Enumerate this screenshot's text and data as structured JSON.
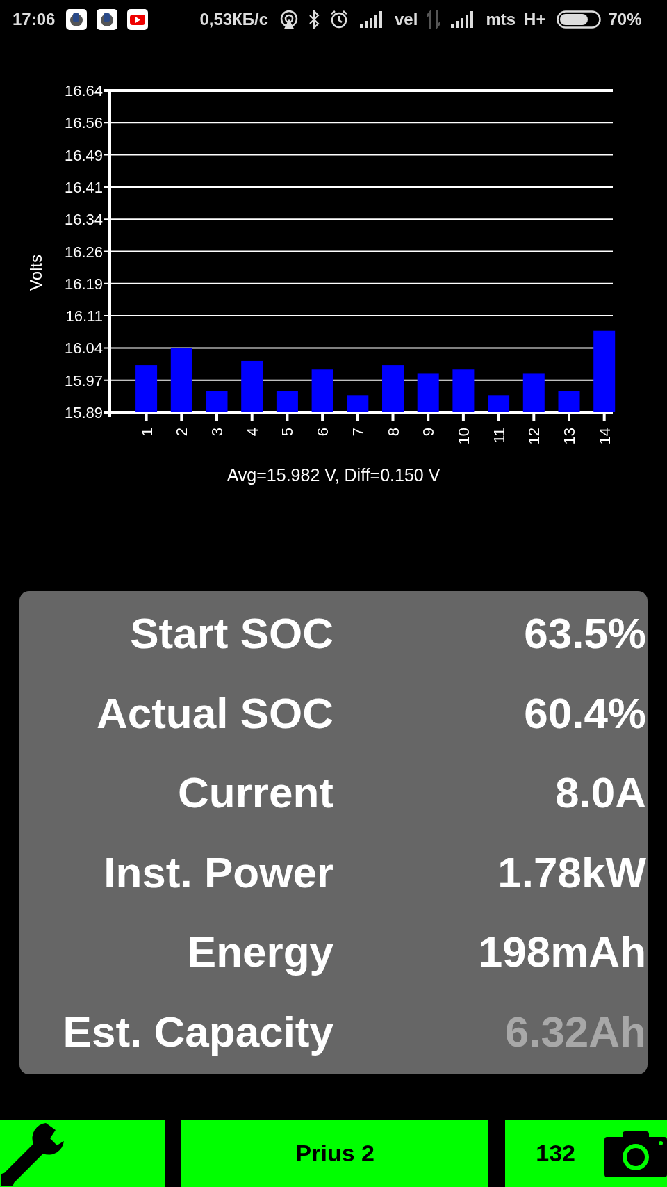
{
  "status_bar": {
    "time": "17:06",
    "speed": "0,53КБ/с",
    "carrier_1": "vel",
    "carrier_2": "mts",
    "network_type": "H+",
    "battery": "70%"
  },
  "chart": {
    "chart_data": {
      "type": "bar",
      "ylabel": "Volts",
      "categories": [
        "1",
        "2",
        "3",
        "4",
        "5",
        "6",
        "7",
        "8",
        "9",
        "10",
        "11",
        "12",
        "13",
        "14"
      ],
      "grid": true,
      "series": [
        {
          "color": "#0000ff",
          "values": [
            16.0,
            16.04,
            15.94,
            16.01,
            15.94,
            15.99,
            15.93,
            16.0,
            15.98,
            15.99,
            15.93,
            15.98,
            15.94,
            16.08
          ]
        }
      ],
      "ylim": [
        15.89,
        16.64
      ],
      "yticks": [
        {
          "value": 15.89,
          "label": "15.89"
        },
        {
          "value": 15.965,
          "label": "15.97"
        },
        {
          "value": 16.04,
          "label": "16.04"
        },
        {
          "value": 16.115,
          "label": "16.11"
        },
        {
          "value": 16.19,
          "label": "16.19"
        },
        {
          "value": 16.265,
          "label": "16.26"
        },
        {
          "value": 16.34,
          "label": "16.34"
        },
        {
          "value": 16.415,
          "label": "16.41"
        },
        {
          "value": 16.49,
          "label": "16.49"
        },
        {
          "value": 16.565,
          "label": "16.56"
        },
        {
          "value": 16.64,
          "label": "16.64"
        }
      ]
    },
    "caption": "Avg=15.982 V, Diff=0.150 V"
  },
  "readings": [
    {
      "label": "Start SOC",
      "value": "63.5%",
      "disabled": false
    },
    {
      "label": "Actual SOC",
      "value": "60.4%",
      "disabled": false
    },
    {
      "label": "Current",
      "value": "8.0A",
      "disabled": false
    },
    {
      "label": "Inst. Power",
      "value": "1.78kW",
      "disabled": false
    },
    {
      "label": "Energy",
      "value": "198mAh",
      "disabled": false
    },
    {
      "label": "Est. Capacity",
      "value": "6.32Ah",
      "disabled": true
    }
  ],
  "bottom_bar": {
    "vehicle": "Prius 2",
    "count": "132"
  }
}
